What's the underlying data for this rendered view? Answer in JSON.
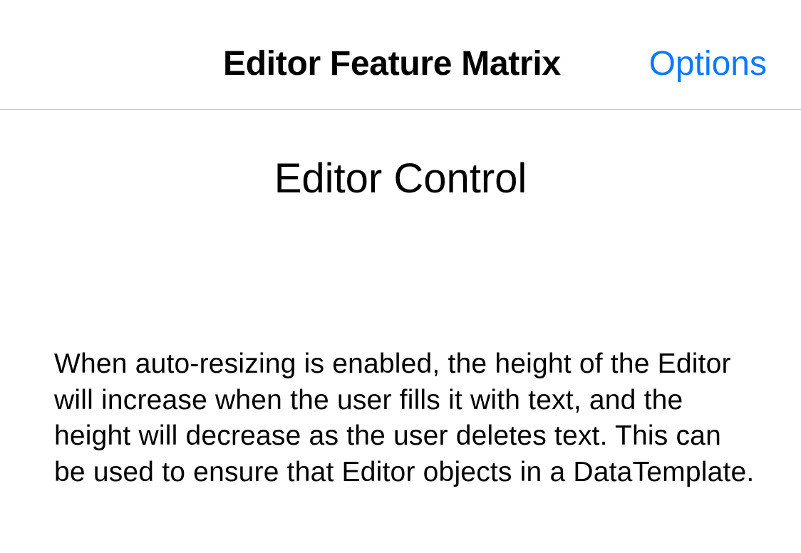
{
  "nav": {
    "title": "Editor Feature Matrix",
    "options_label": "Options"
  },
  "content": {
    "title": "Editor Control",
    "editor_text": "",
    "description": "When auto-resizing is enabled, the height of the Editor will increase when the user fills it with text, and the height will decrease as the user deletes text. This can be used to ensure that Editor objects in a DataTemplate."
  },
  "colors": {
    "accent": "#0a7aff",
    "separator": "#c8c7cc",
    "background": "#ffffff"
  }
}
